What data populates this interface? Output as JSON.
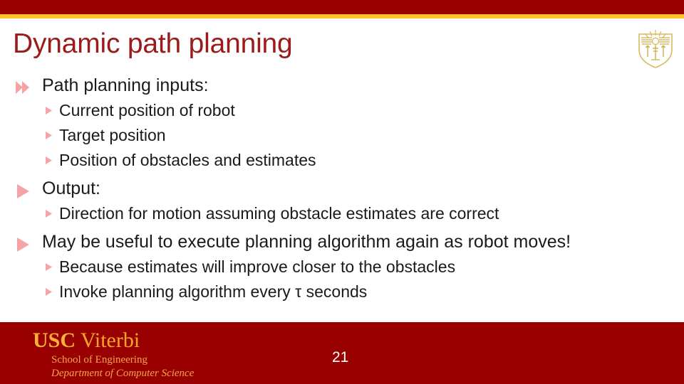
{
  "theme": {
    "bar_red": "#990000",
    "bar_gold": "#ffc425",
    "title_color": "#9b1b1b",
    "bullet_marker_color": "#f5a3a3",
    "body_text_color": "#1a1a1a",
    "footer_band": "#990000",
    "footer_gold": "#f7a823"
  },
  "header": {
    "title": "Dynamic path planning",
    "logo_name": "usc-shield-logo"
  },
  "body": {
    "bullets": [
      {
        "level": 1,
        "marker": "chevron",
        "text": "Path planning inputs:"
      },
      {
        "level": 2,
        "marker": "triangle",
        "text": "Current position of robot"
      },
      {
        "level": 2,
        "marker": "triangle",
        "text": "Target position"
      },
      {
        "level": 2,
        "marker": "triangle",
        "text": "Position of obstacles and estimates"
      },
      {
        "level": 1,
        "marker": "triangle",
        "text": "Output:"
      },
      {
        "level": 2,
        "marker": "triangle",
        "text": "Direction for motion assuming obstacle estimates are correct"
      },
      {
        "level": 1,
        "marker": "triangle",
        "text": "May be useful to execute planning algorithm again as robot moves!"
      },
      {
        "level": 2,
        "marker": "triangle",
        "text": "Because estimates will improve closer to the obstacles"
      },
      {
        "level": 2,
        "marker": "triangle",
        "text": "Invoke planning algorithm every τ seconds"
      }
    ]
  },
  "footer": {
    "brand_primary": "USC",
    "brand_secondary": "Viterbi",
    "school": "School of Engineering",
    "department": "Department of Computer Science",
    "page_number": "21"
  }
}
